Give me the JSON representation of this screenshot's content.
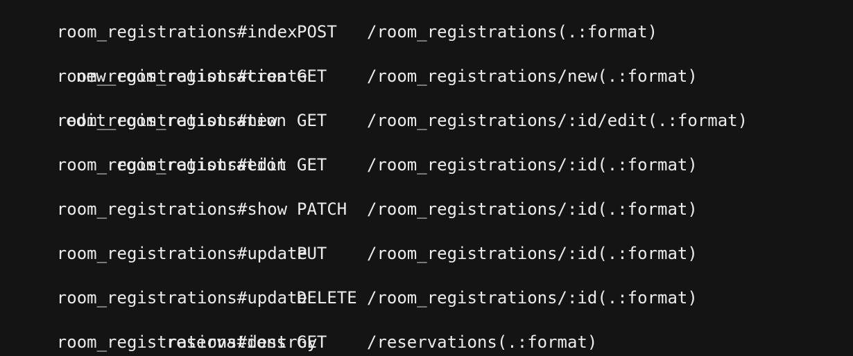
{
  "terminal": {
    "lines": [
      {
        "kind": "action",
        "text": "room_registrations#index"
      },
      {
        "kind": "route",
        "name": "",
        "verb": "POST",
        "path": "/room_registrations(.:format)"
      },
      {
        "kind": "action",
        "text": "room_registrations#create"
      },
      {
        "kind": "route",
        "name": "new_room_registration",
        "verb": "GET",
        "path": "/room_registrations/new(.:format)"
      },
      {
        "kind": "action",
        "text": "room_registrations#new"
      },
      {
        "kind": "route",
        "name": "edit_room_registration",
        "verb": "GET",
        "path": "/room_registrations/:id/edit(.:format)"
      },
      {
        "kind": "action",
        "text": "room_registrations#edit"
      },
      {
        "kind": "route",
        "name": "room_registration",
        "verb": "GET",
        "path": "/room_registrations/:id(.:format)"
      },
      {
        "kind": "action",
        "text": "room_registrations#show"
      },
      {
        "kind": "route",
        "name": "",
        "verb": "PATCH",
        "path": "/room_registrations/:id(.:format)"
      },
      {
        "kind": "action",
        "text": "room_registrations#update"
      },
      {
        "kind": "route",
        "name": "",
        "verb": "PUT",
        "path": "/room_registrations/:id(.:format)"
      },
      {
        "kind": "action",
        "text": "room_registrations#update"
      },
      {
        "kind": "route",
        "name": "",
        "verb": "DELETE",
        "path": "/room_registrations/:id(.:format)"
      },
      {
        "kind": "action",
        "text": "room_registrations#destroy"
      },
      {
        "kind": "route",
        "name": "reservations",
        "verb": "GET",
        "path": "/reservations(.:format)"
      }
    ]
  }
}
